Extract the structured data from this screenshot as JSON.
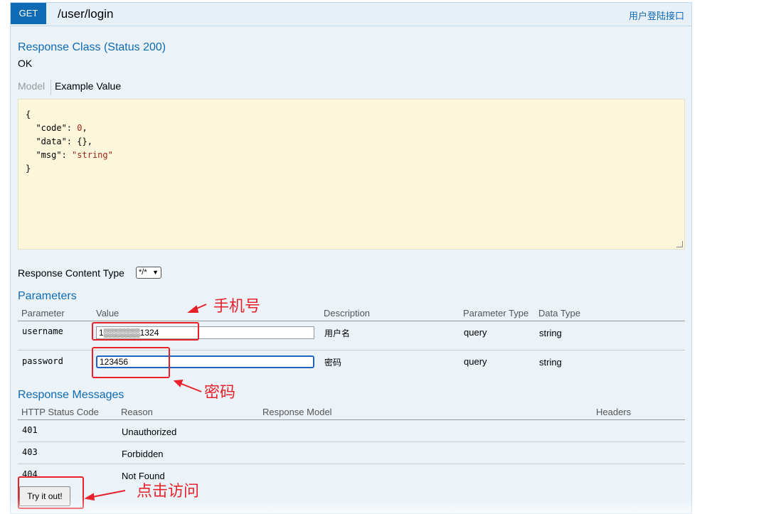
{
  "operation": {
    "method": "GET",
    "path": "/user/login",
    "summary": "用户登陆接口"
  },
  "response_class": {
    "heading": "Response Class (Status 200)",
    "status_text": "OK",
    "tabs": [
      "Model",
      "Example Value"
    ],
    "example_lines": [
      "{",
      "  \"code\": 0,",
      "  \"data\": {},",
      "  \"msg\": \"string\"",
      "}"
    ]
  },
  "response_content_type": {
    "label": "Response Content Type",
    "selected": "*/*"
  },
  "parameters": {
    "heading": "Parameters",
    "columns": [
      "Parameter",
      "Value",
      "Description",
      "Parameter Type",
      "Data Type"
    ],
    "rows": [
      {
        "name": "username",
        "value": "1▒▒▒▒▒▒1324",
        "description": "用户名",
        "param_type": "query",
        "data_type": "string"
      },
      {
        "name": "password",
        "value": "123456",
        "description": "密码",
        "param_type": "query",
        "data_type": "string"
      }
    ]
  },
  "response_messages": {
    "heading": "Response Messages",
    "columns": [
      "HTTP Status Code",
      "Reason",
      "Response Model",
      "Headers"
    ],
    "rows": [
      {
        "code": "401",
        "reason": "Unauthorized"
      },
      {
        "code": "403",
        "reason": "Forbidden"
      },
      {
        "code": "404",
        "reason": "Not Found"
      }
    ]
  },
  "try_button": "Try it out!",
  "annotations": {
    "phone": "手机号",
    "password": "密码",
    "click": "点击访问"
  },
  "colors": {
    "accent": "#0f6ab4",
    "annotation": "#e8212b",
    "panel_bg": "#ebf3f9",
    "code_bg": "#fcf6db"
  }
}
